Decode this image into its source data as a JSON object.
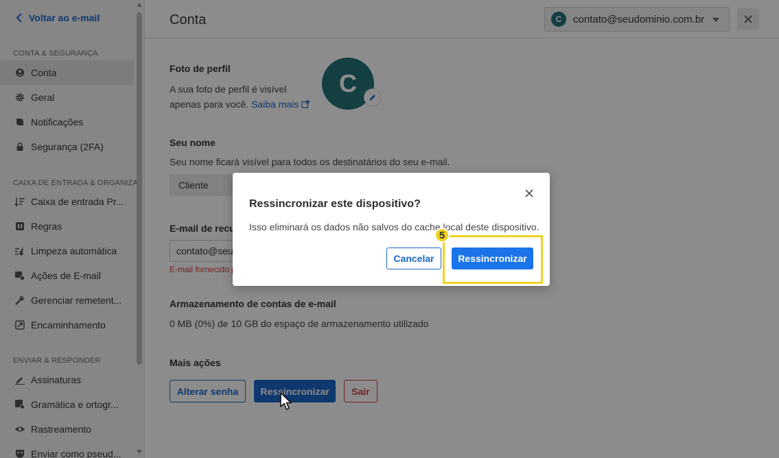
{
  "sidebar": {
    "back_label": "Voltar ao e-mail",
    "sections": {
      "account": "CONTA & SEGURANÇA",
      "inbox": "CAIXA DE ENTRADA & ORGANIZA...",
      "send": "ENVIAR & RESPONDER"
    },
    "items": [
      {
        "label": "Conta",
        "icon": "account-circle-icon",
        "active": true
      },
      {
        "label": "Geral",
        "icon": "gear-icon"
      },
      {
        "label": "Notificações",
        "icon": "bell-icon"
      },
      {
        "label": "Segurança (2FA)",
        "icon": "lock-icon"
      },
      {
        "label": "Caixa de entrada Pr...",
        "icon": "sort-icon"
      },
      {
        "label": "Regras",
        "icon": "rules-icon"
      },
      {
        "label": "Limpeza automática",
        "icon": "broom-icon"
      },
      {
        "label": "Ações de E-mail",
        "icon": "email-actions-icon"
      },
      {
        "label": "Gerenciar remetent...",
        "icon": "wrench-icon"
      },
      {
        "label": "Encaminhamento",
        "icon": "forward-icon"
      },
      {
        "label": "Assinaturas",
        "icon": "pen-icon"
      },
      {
        "label": "Gramática e ortogr...",
        "icon": "grammar-icon"
      },
      {
        "label": "Rastreamento",
        "icon": "eye-icon"
      },
      {
        "label": "Enviar como pseud...",
        "icon": "mask-icon"
      }
    ]
  },
  "header": {
    "title": "Conta",
    "account_initial": "C",
    "account_email": "contato@seudominio.com.br"
  },
  "profile": {
    "photo_label": "Foto de perfil",
    "photo_desc_line1": "A sua foto de perfil é visível",
    "photo_desc_line2": "apenas para você.",
    "learn_more": "Saiba mais",
    "avatar_initial": "C",
    "name_label": "Seu nome",
    "name_desc": "Seu nome ficará visível para todos os destinatários do seu e-mail.",
    "name_value": "Cliente",
    "recovery_label": "E-mail de recu",
    "recovery_value": "contato@seu",
    "recovery_error": "E-mail fornecido p",
    "storage_label": "Armazenamento de contas de e-mail",
    "storage_desc": "0 MB (0%) de 10 GB do espaço de armazenamento utilizado",
    "more_actions_label": "Mais ações",
    "btn_change_password": "Alterar senha",
    "btn_resync": "Ressincronizar",
    "btn_logout": "Sair"
  },
  "modal": {
    "title": "Ressincronizar este dispositivo?",
    "body": "Isso eliminará os dados não salvos do cache local deste dispositivo.",
    "cancel": "Cancelar",
    "confirm": "Ressincronizar",
    "step_number": "5"
  },
  "colors": {
    "accent": "#1a66c9",
    "avatar": "#23737a",
    "highlight": "#f0d31e",
    "danger": "#d23b3b"
  }
}
